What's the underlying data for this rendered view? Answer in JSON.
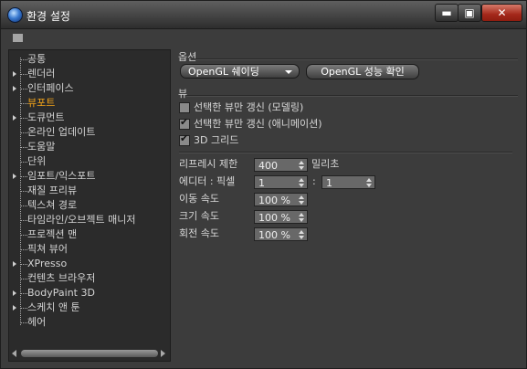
{
  "window": {
    "title": "환경 설정",
    "min_label": "▬",
    "max_label": "▣",
    "close_label": "✕",
    "app_icon": "cinema4d-sphere-icon",
    "grip_icon": "grip-dots-icon"
  },
  "sidebar": {
    "items": [
      {
        "label": "공통",
        "expandable": false,
        "selected": false
      },
      {
        "label": "렌더러",
        "expandable": true,
        "selected": false
      },
      {
        "label": "인터페이스",
        "expandable": true,
        "selected": false
      },
      {
        "label": "뷰포트",
        "expandable": false,
        "selected": true
      },
      {
        "label": "도큐먼트",
        "expandable": true,
        "selected": false
      },
      {
        "label": "온라인 업데이트",
        "expandable": false,
        "selected": false
      },
      {
        "label": "도움말",
        "expandable": false,
        "selected": false
      },
      {
        "label": "단위",
        "expandable": false,
        "selected": false
      },
      {
        "label": "임포트/익스포트",
        "expandable": true,
        "selected": false
      },
      {
        "label": "재질 프리뷰",
        "expandable": false,
        "selected": false
      },
      {
        "label": "텍스쳐 경로",
        "expandable": false,
        "selected": false
      },
      {
        "label": "타임라인/오브젝트 매니저",
        "expandable": false,
        "selected": false
      },
      {
        "label": "프로젝션 맨",
        "expandable": false,
        "selected": false
      },
      {
        "label": "픽쳐 뷰어",
        "expandable": false,
        "selected": false
      },
      {
        "label": "XPresso",
        "expandable": true,
        "selected": false
      },
      {
        "label": "컨텐츠 브라우저",
        "expandable": false,
        "selected": false
      },
      {
        "label": "BodyPaint 3D",
        "expandable": true,
        "selected": false
      },
      {
        "label": "스케치 앤 툰",
        "expandable": true,
        "selected": false
      },
      {
        "label": "헤어",
        "expandable": false,
        "selected": false
      }
    ],
    "selected_color": "#f2a319"
  },
  "options": {
    "title": "옵션",
    "shading_dropdown": "OpenGL 쉐이딩",
    "check_button": "OpenGL 성능 확인"
  },
  "view": {
    "title": "뷰",
    "checkboxes": [
      {
        "label": "선택한 뷰만 갱신 (모델링)",
        "checked": false
      },
      {
        "label": "선택한 뷰만 갱신 (애니메이션)",
        "checked": true
      },
      {
        "label": "3D 그리드",
        "checked": true
      }
    ],
    "refresh_limit": {
      "label": "리프레시 제한",
      "value": "400",
      "unit": "밀리초"
    },
    "editor_pixel": {
      "label": "에디터 : 픽셀",
      "value1": "1",
      "separator": ":",
      "value2": "1"
    },
    "move_speed": {
      "label": "이동 속도",
      "value": "100 %"
    },
    "scale_speed": {
      "label": "크기 속도",
      "value": "100 %"
    },
    "rotate_speed": {
      "label": "회전 속도",
      "value": "100 %"
    }
  }
}
